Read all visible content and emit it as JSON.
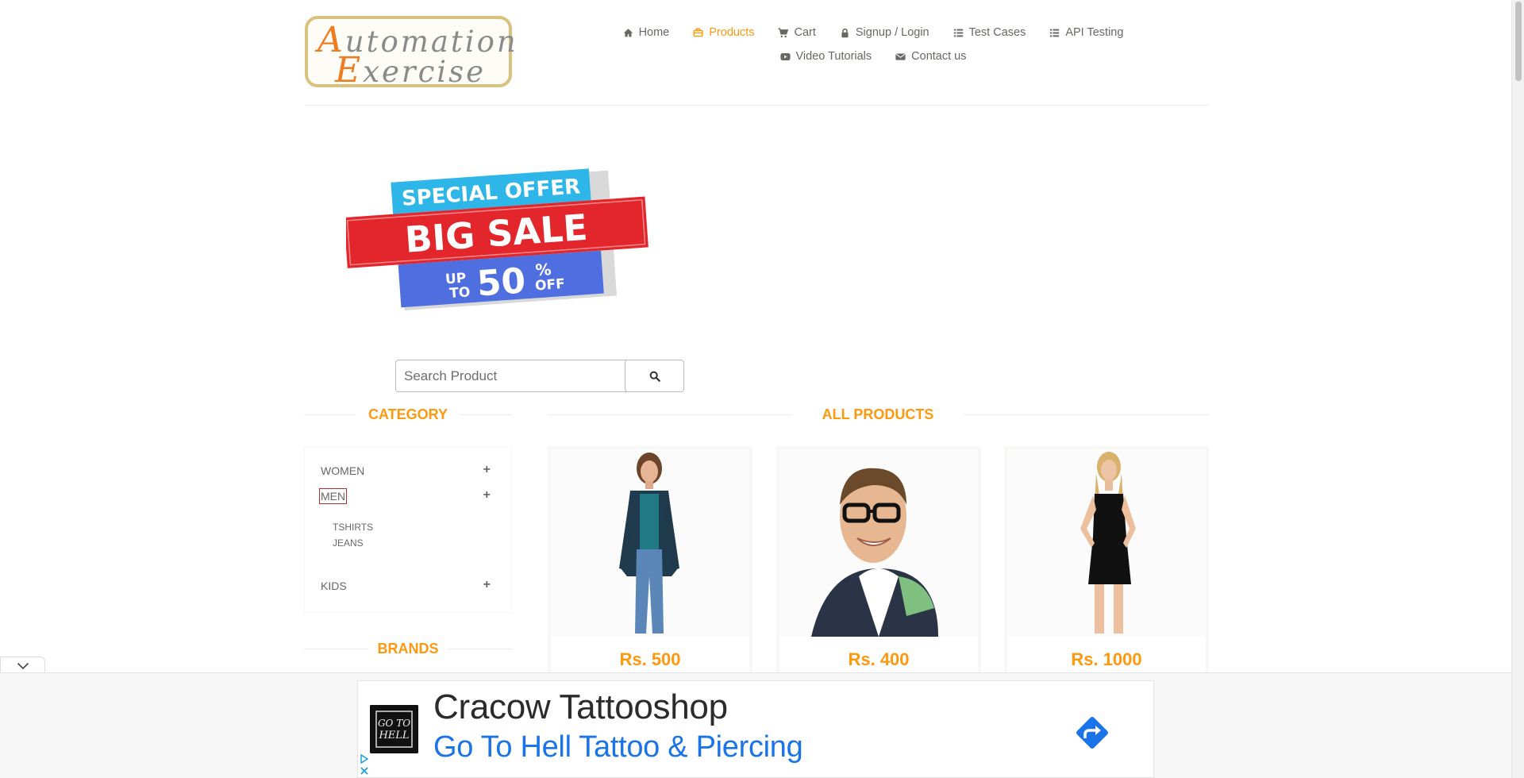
{
  "header": {
    "logo": {
      "line1_cap": "A",
      "line1_rest": "utomation",
      "line2_cap": "E",
      "line2_rest": "xercise"
    },
    "nav": [
      {
        "label": "Home",
        "icon": "home-icon"
      },
      {
        "label": "Products",
        "icon": "products-icon",
        "active": true
      },
      {
        "label": "Cart",
        "icon": "cart-icon"
      },
      {
        "label": "Signup / Login",
        "icon": "lock-icon"
      },
      {
        "label": "Test Cases",
        "icon": "list-icon"
      },
      {
        "label": "API Testing",
        "icon": "list-icon"
      },
      {
        "label": "Video Tutorials",
        "icon": "youtube-icon"
      },
      {
        "label": "Contact us",
        "icon": "envelope-icon"
      }
    ]
  },
  "banner": {
    "line1": "SPECIAL OFFER",
    "line2": "BIG SALE",
    "up": "UP",
    "to": "TO",
    "percent_value": "50",
    "percent_sign": "%",
    "off": "OFF"
  },
  "search": {
    "placeholder": "Search Product",
    "value": ""
  },
  "sidebar": {
    "category_title": "Category",
    "categories": [
      {
        "label": "Women",
        "toggle": "+"
      },
      {
        "label": "Men",
        "toggle": "+",
        "expanded": true,
        "subcategories": [
          "Tshirts",
          "Jeans"
        ]
      },
      {
        "label": "Kids",
        "toggle": "+"
      }
    ],
    "brands_title": "Brands"
  },
  "products": {
    "title": "All Products",
    "items": [
      {
        "price": "Rs. 500"
      },
      {
        "price": "Rs. 400"
      },
      {
        "price": "Rs. 1000"
      }
    ]
  },
  "ad": {
    "title": "Cracow Tattooshop",
    "subtitle": "Go To Hell Tattoo & Piercing",
    "logo_text_line1": "GO TO",
    "logo_text_line2": "HELL"
  },
  "colors": {
    "accent": "#fe980f",
    "logo_orange": "#f07c22",
    "logo_border": "#d9c27f",
    "text": "#696763",
    "ad_link": "#1a73e8",
    "banner_red": "#e3262c",
    "banner_cyan": "#2fb6e8",
    "banner_blue": "#4f6ee0"
  }
}
